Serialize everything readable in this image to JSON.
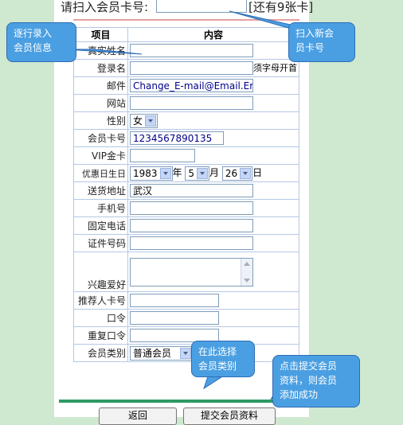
{
  "header": {
    "scan_label": "请扫入会员卡号:",
    "scan_value": "",
    "remaining_text": "[还有9张卡]"
  },
  "table": {
    "col_item": "项目",
    "col_content": "内容",
    "rows": {
      "realname": "真实姓名",
      "login": "登录名",
      "login_hint": "须字母开首",
      "email": "邮件",
      "email_value": "Change_E-mail@Email.Er",
      "website": "网站",
      "gender": "性别",
      "gender_value": "女",
      "card_no": "会员卡号",
      "card_value": "1234567890135",
      "vip": "VIP金卡",
      "birthday": "优惠日生日",
      "year_value": "1983",
      "year_unit": "年",
      "month_value": "5",
      "month_unit": "月",
      "day_value": "26",
      "day_unit": "日",
      "address": "送货地址",
      "address_value": "武汉",
      "mobile": "手机号",
      "phone": "固定电话",
      "id_no": "证件号码",
      "hobby": "兴趣爱好",
      "referrer": "推荐人卡号",
      "password": "口令",
      "password_repeat": "重复口令",
      "member_type": "会员类别",
      "member_type_value": "普通会员"
    }
  },
  "buttons": {
    "reset": "返回",
    "submit": "提交会员资料"
  },
  "callouts": {
    "enter_info": "逐行录入\n会员信息",
    "scan_card": "扫入新会\n员卡号",
    "choose_type": "在此选择\n会员类别",
    "submit_hint": "点击提交会员\n资料，则会员\n添加成功"
  },
  "colors": {
    "callout": "#4a9fe2",
    "background": "#cfe8d0",
    "green_bar": "#2e9966"
  }
}
